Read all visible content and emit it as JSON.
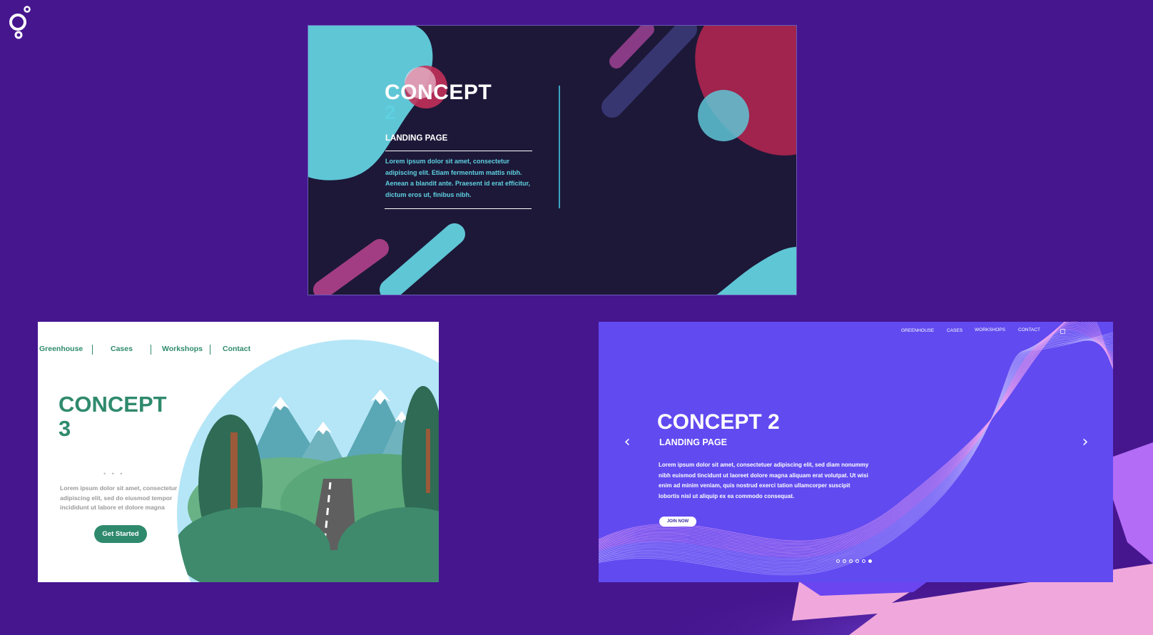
{
  "colors": {
    "background": "#46168f",
    "card1_bg": "#1d1838",
    "card1_accent": "#5fd0e0",
    "card1_pink": "#c2305a",
    "card2_green": "#2f8a6d",
    "card3_bg": "#614af0"
  },
  "logo": {
    "icon": "brand-logo-icon"
  },
  "concept_dark": {
    "title": "CONCEPT",
    "number": "2",
    "subtitle": "LANDING PAGE",
    "body": "Lorem ipsum dolor sit amet, consectetur adipiscing elit. Etiam fermentum mattis nibh. Aenean a blandit ante. Praesent id erat efficitur, dictum eros ut, finibus nibh."
  },
  "concept_green": {
    "nav": [
      "Greenhouse",
      "Cases",
      "Workshops",
      "Contact"
    ],
    "title_line1": "CONCEPT",
    "title_line2": "3",
    "dots": "• • •",
    "body": "Lorem ipsum dolor sit amet, consectetur adipiscing elit, sed do eiusmod tempor incididunt ut labore et dolore magna",
    "button": "Get Started"
  },
  "concept_purple": {
    "nav": [
      "GREENHOUSE",
      "CASES",
      "WORKSHOPS",
      "CONTACT"
    ],
    "menu_icon": "grid-menu-icon",
    "title": "CONCEPT 2",
    "subtitle": "LANDING PAGE",
    "body": "Lorem ipsum dolor sit amet, consectetuer adipiscing elit, sed diam nonummy nibh euismod tincidunt ut laoreet dolore magna aliquam erat volutpat. Ut wisi enim ad minim veniam, quis nostrud exerci tation ullamcorper suscipit lobortis nisl ut aliquip ex ea commodo consequat.",
    "button": "JOIN NOW",
    "prev": "‹",
    "next": "›",
    "slide_count": 6,
    "active_slide": 6
  }
}
